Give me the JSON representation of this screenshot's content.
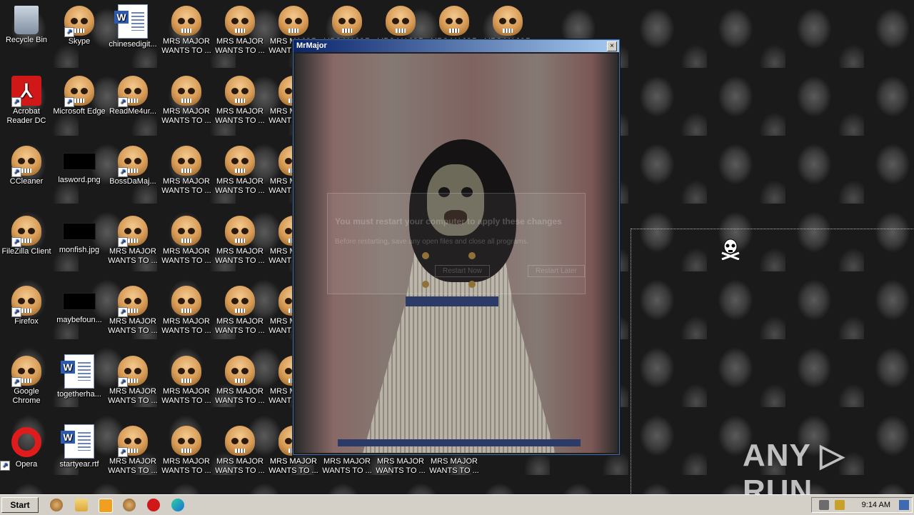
{
  "desktop": {
    "column1": [
      {
        "label": "Recycle Bin",
        "icon": "recycle-bin-icon"
      },
      {
        "label": "Acrobat\nReader DC",
        "icon": "acrobat-icon"
      },
      {
        "label": "CCleaner",
        "icon": "skull-icon"
      },
      {
        "label": "FileZilla Client",
        "icon": "skull-icon"
      },
      {
        "label": "Firefox",
        "icon": "skull-icon"
      },
      {
        "label": "Google\nChrome",
        "icon": "skull-icon"
      },
      {
        "label": "Opera",
        "icon": "opera-icon"
      }
    ],
    "column2": [
      {
        "label": "Skype",
        "icon": "skull-icon"
      },
      {
        "label": "Microsoft Edge",
        "icon": "skull-icon"
      },
      {
        "label": "lasword.png",
        "icon": "image-file-icon"
      },
      {
        "label": "monfish.jpg",
        "icon": "image-file-icon"
      },
      {
        "label": "maybefoun...",
        "icon": "image-file-icon"
      },
      {
        "label": "togetherha...",
        "icon": "word-doc-icon"
      },
      {
        "label": "startyear.rtf",
        "icon": "word-doc-icon"
      }
    ],
    "column3": [
      {
        "label": "chinesedigit...",
        "icon": "word-doc-icon"
      },
      {
        "label": "ReadMe4ur...",
        "icon": "skull-icon"
      },
      {
        "label": "BossDaMaj...",
        "icon": "skull-icon"
      },
      {
        "label": "MRS MAJOR\nWANTS TO ...",
        "icon": "skull-icon"
      },
      {
        "label": "MRS MAJOR\nWANTS TO ...",
        "icon": "skull-icon"
      },
      {
        "label": "MRS MAJOR\nWANTS TO ...",
        "icon": "skull-icon"
      },
      {
        "label": "MRS MAJOR\nWANTS TO ...",
        "icon": "skull-icon"
      }
    ],
    "mrs_major_label": "MRS MAJOR\nWANTS TO ..."
  },
  "popup": {
    "title": "MrMajor",
    "close_glyph": "×",
    "ghost_heading": "You must restart your computer to apply these changes",
    "ghost_text": "Before restarting, save any open files and close all programs.",
    "ghost_button1": "Restart Now",
    "ghost_button2": "Restart Later"
  },
  "watermark": "ANY ▷ RUN",
  "taskbar": {
    "start_label": "Start",
    "clock": "9:14 AM"
  }
}
